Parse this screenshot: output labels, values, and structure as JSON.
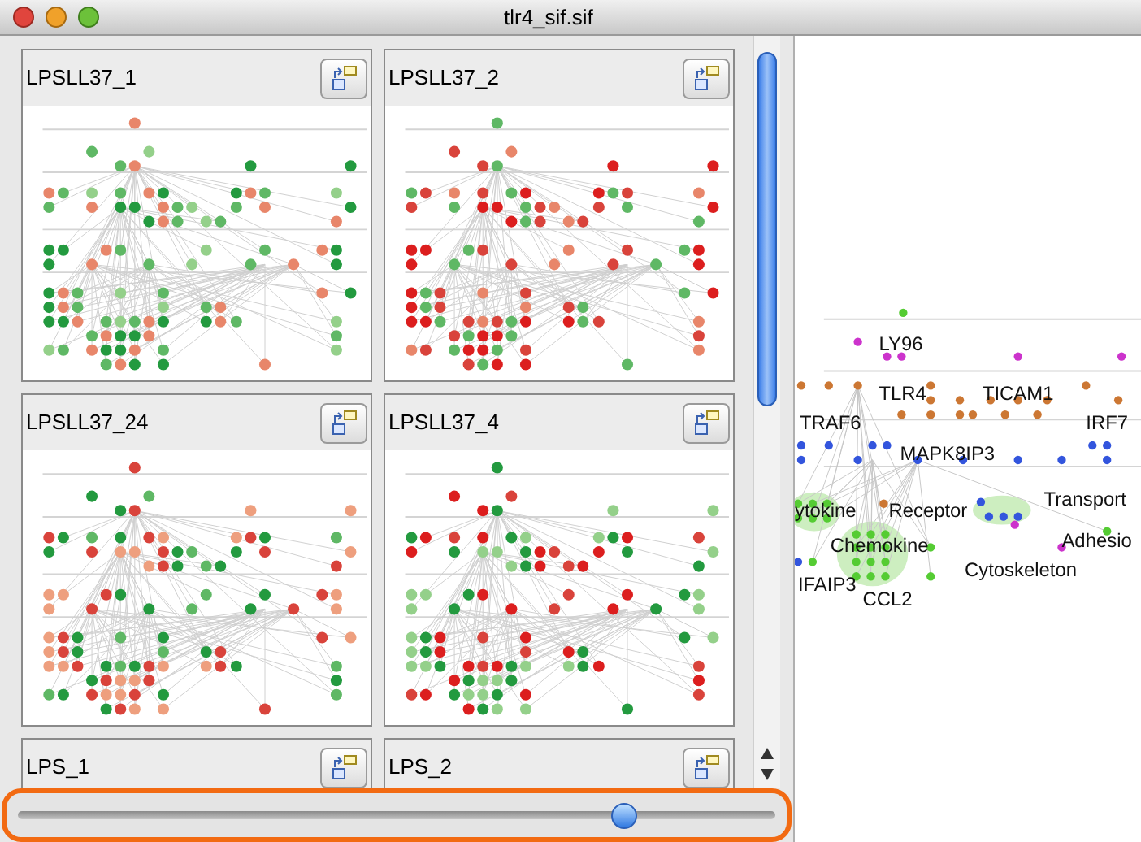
{
  "window": {
    "title": "tlr4_sif.sif"
  },
  "panels": [
    {
      "title": "LPSLL37_1"
    },
    {
      "title": "LPSLL37_2"
    },
    {
      "title": "LPSLL37_24"
    },
    {
      "title": "LPSLL37_4"
    },
    {
      "title": "LPS_1"
    },
    {
      "title": "LPS_2"
    }
  ],
  "network": {
    "labels": [
      "LY96",
      "TLR4",
      "TICAM1",
      "TRAF6",
      "IRF7",
      "MAPK8IP3",
      "ytokine",
      "Receptor",
      "Transport",
      "Chemokine",
      "Adhesio",
      "IFAIP3",
      "Cytoskeleton",
      "CCL2"
    ]
  },
  "slider": {
    "level": 0.8
  }
}
